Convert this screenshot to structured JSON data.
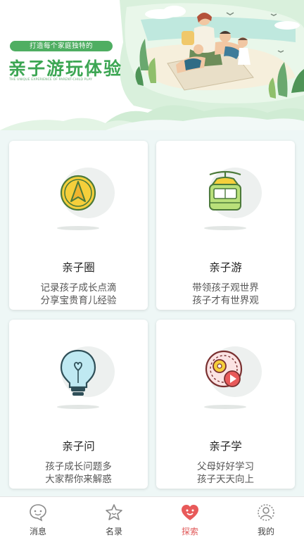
{
  "banner": {
    "tagline": "打造每个家庭独特的",
    "title": "亲子游玩体验",
    "subtitle": "THE UNIQUE EXPERIENCE OF PARENT-CHILD PLAY"
  },
  "cards": [
    {
      "title": "亲子圈",
      "desc_line1": "记录孩子成长点滴",
      "desc_line2": "分享宝贵育儿经验",
      "icon": "compass-icon"
    },
    {
      "title": "亲子游",
      "desc_line1": "带领孩子观世界",
      "desc_line2": "孩子才有世界观",
      "icon": "cable-car-icon"
    },
    {
      "title": "亲子问",
      "desc_line1": "孩子成长问题多",
      "desc_line2": "大家帮你来解惑",
      "icon": "lightbulb-icon"
    },
    {
      "title": "亲子学",
      "desc_line1": "父母好好学习",
      "desc_line2": "孩子天天向上",
      "icon": "gear-play-icon"
    }
  ],
  "nav": {
    "items": [
      {
        "label": "消息",
        "icon": "chat-icon"
      },
      {
        "label": "名录",
        "icon": "star-icon"
      },
      {
        "label": "探索",
        "icon": "heart-face-icon",
        "active": true
      },
      {
        "label": "我的",
        "icon": "profile-icon"
      }
    ]
  },
  "colors": {
    "brand_green": "#3ca653",
    "accent_red": "#e15a5a",
    "background": "#eef7f6"
  }
}
